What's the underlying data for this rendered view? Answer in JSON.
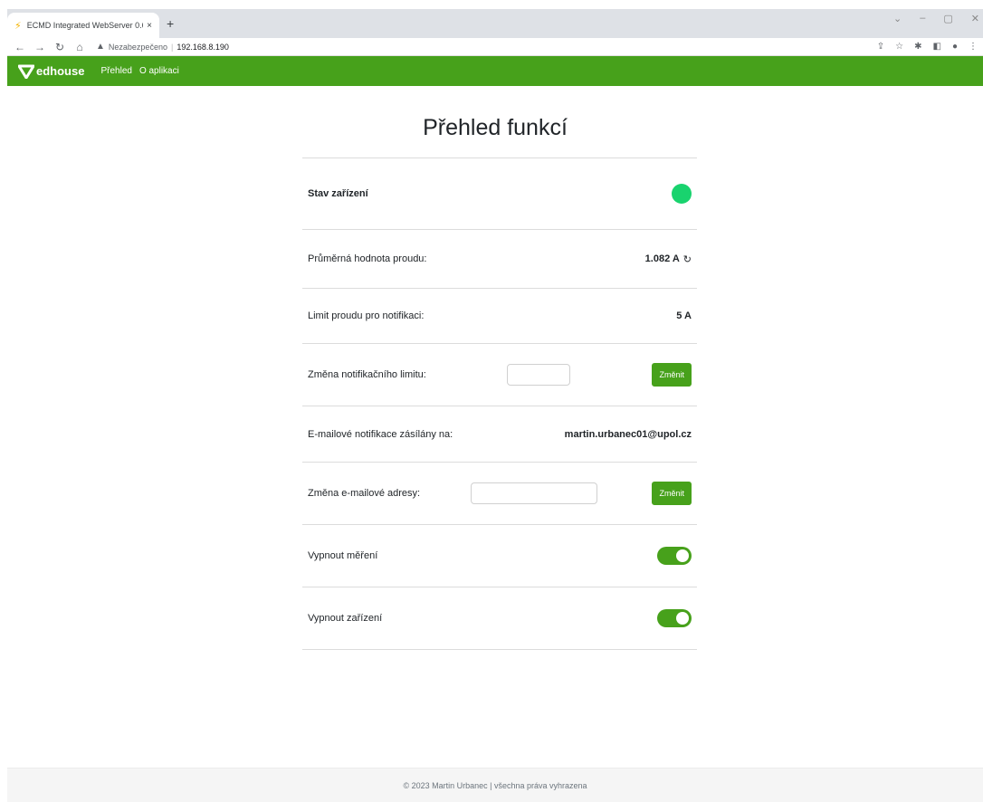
{
  "browser": {
    "tab_title": "ECMD Integrated WebServer 0.6",
    "tab_close": "×",
    "new_tab": "+",
    "security_label": "Nezabezpečeno",
    "url": "192.168.8.190"
  },
  "navbar": {
    "brand": "edhouse",
    "links": [
      "Přehled",
      "O aplikaci"
    ]
  },
  "page": {
    "title": "Přehled funkcí"
  },
  "rows": {
    "status_label": "Stav zařízení",
    "status_color": "#19d36e",
    "avg_current_label": "Průměrná hodnota proudu:",
    "avg_current_value": "1.082 A",
    "limit_label": "Limit proudu pro notifikaci:",
    "limit_value": "5 A",
    "change_limit_label": "Změna notifikačního limitu:",
    "change_limit_button": "Změnit",
    "email_label": "E-mailové notifikace zásílány na:",
    "email_value": "martin.urbanec01@upol.cz",
    "change_email_label": "Změna e-mailové adresy:",
    "change_email_button": "Změnit",
    "measure_off_label": "Vypnout měření",
    "device_off_label": "Vypnout zařízení"
  },
  "footer": {
    "text": "© 2023 Martin Urbanec | všechna práva vyhrazena"
  },
  "colors": {
    "brand": "#47a11b",
    "status_ok": "#19d36e"
  }
}
